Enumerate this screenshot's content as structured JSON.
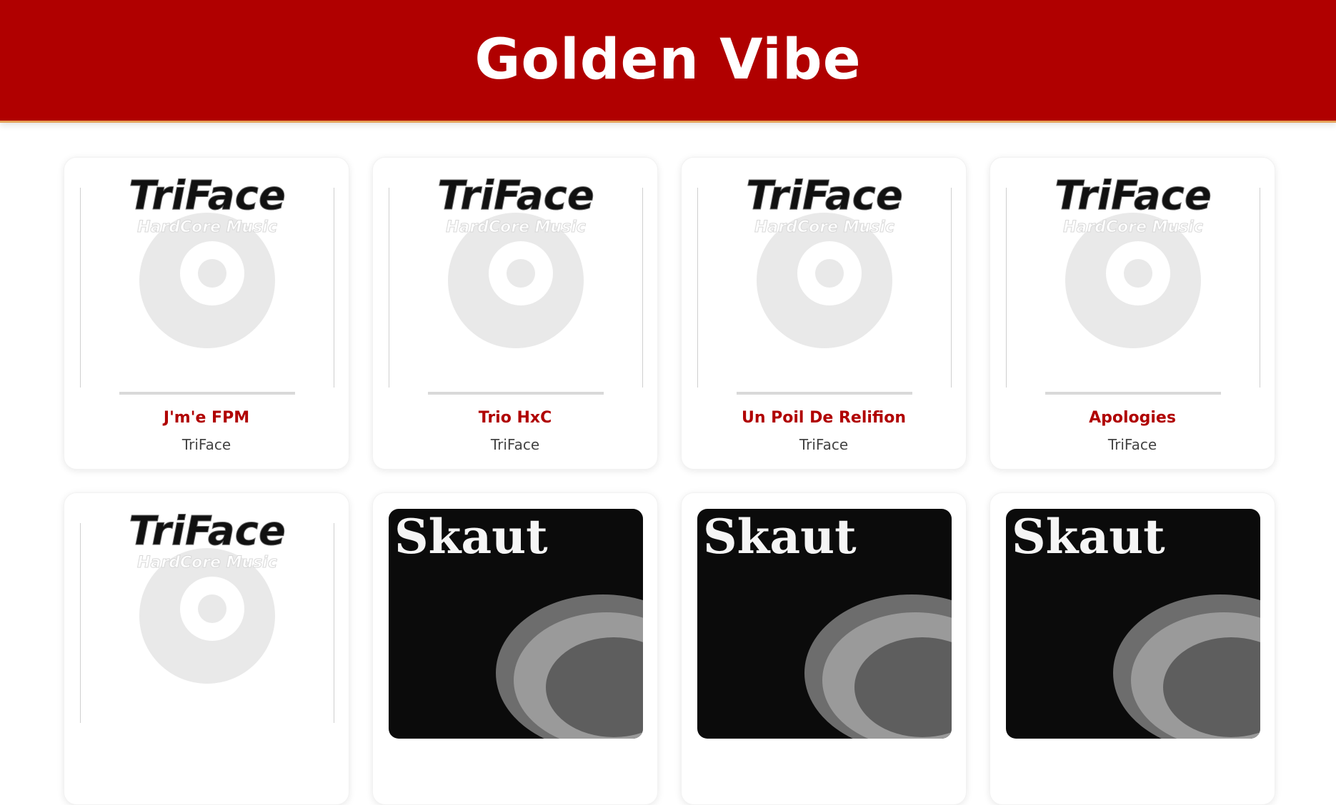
{
  "header": {
    "title": "Golden Vibe"
  },
  "colors": {
    "brand": "#b00000",
    "accent": "#e5a25a",
    "artist_text": "#444444"
  },
  "tracks": [
    {
      "title": "J'm'e FPM",
      "artist": "TriFace",
      "cover": "triface-cover"
    },
    {
      "title": "Trio HxC",
      "artist": "TriFace",
      "cover": "triface-cover"
    },
    {
      "title": "Un Poil De Relifion",
      "artist": "TriFace",
      "cover": "triface-cover"
    },
    {
      "title": "Apologies",
      "artist": "TriFace",
      "cover": "triface-cover"
    },
    {
      "title": "",
      "artist": "",
      "cover": "triface-cover",
      "logo_text": "TriFace",
      "logo_sub": "HardCore Music"
    },
    {
      "title": "",
      "artist": "",
      "cover": "skaut-cover",
      "logo_text": "Skaut"
    },
    {
      "title": "",
      "artist": "",
      "cover": "skaut-cover",
      "logo_text": "Skaut"
    },
    {
      "title": "",
      "artist": "",
      "cover": "skaut-cover",
      "logo_text": "Skaut"
    }
  ],
  "cover_logos": {
    "triface": "TriFace",
    "triface_sub": "HardCore Music",
    "skaut": "Skaut"
  }
}
